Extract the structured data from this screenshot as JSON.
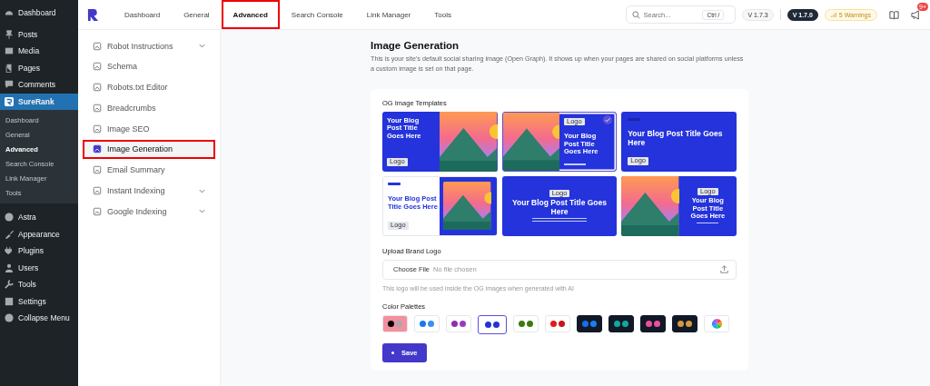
{
  "wp_menu": [
    {
      "label": "Dashboard",
      "current": false
    },
    {
      "label": "Posts",
      "current": false
    },
    {
      "label": "Media",
      "current": false
    },
    {
      "label": "Pages",
      "current": false
    },
    {
      "label": "Comments",
      "current": false
    },
    {
      "label": "SureRank",
      "current": true,
      "submenu": [
        {
          "label": "Dashboard",
          "selected": false
        },
        {
          "label": "General",
          "selected": false
        },
        {
          "label": "Advanced",
          "selected": true
        },
        {
          "label": "Search Console",
          "selected": false
        },
        {
          "label": "Link Manager",
          "selected": false
        },
        {
          "label": "Tools",
          "selected": false
        }
      ]
    },
    {
      "label": "Astra",
      "current": false
    },
    {
      "label": "Appearance",
      "current": false
    },
    {
      "label": "Plugins",
      "current": false
    },
    {
      "label": "Users",
      "current": false
    },
    {
      "label": "Tools",
      "current": false
    },
    {
      "label": "Settings",
      "current": false
    },
    {
      "label": "Collapse Menu",
      "current": false
    }
  ],
  "top_tabs": [
    {
      "label": "Dashboard",
      "selected": false,
      "highlighted": false
    },
    {
      "label": "General",
      "selected": false,
      "highlighted": false
    },
    {
      "label": "Advanced",
      "selected": true,
      "highlighted": true
    },
    {
      "label": "Search Console",
      "selected": false,
      "highlighted": false
    },
    {
      "label": "Link Manager",
      "selected": false,
      "highlighted": false
    },
    {
      "label": "Tools",
      "selected": false,
      "highlighted": false
    }
  ],
  "search": {
    "placeholder": "Search...",
    "shortcut": "Ctrl /"
  },
  "versions": [
    {
      "label": "V 1.7.3",
      "kind": "light"
    },
    {
      "label": "V 1.7.0",
      "kind": "dark"
    }
  ],
  "warnings": "5 Warnings",
  "notification_count": "9+",
  "side_nav": [
    {
      "label": "Robot Instructions",
      "expandable": true,
      "selected": false,
      "highlighted": false
    },
    {
      "label": "Schema",
      "expandable": false,
      "selected": false,
      "highlighted": false
    },
    {
      "label": "Robots.txt Editor",
      "expandable": false,
      "selected": false,
      "highlighted": false
    },
    {
      "label": "Breadcrumbs",
      "expandable": false,
      "selected": false,
      "highlighted": false
    },
    {
      "label": "Image SEO",
      "expandable": false,
      "selected": false,
      "highlighted": false
    },
    {
      "label": "Image Generation",
      "expandable": false,
      "selected": true,
      "highlighted": true
    },
    {
      "label": "Email Summary",
      "expandable": false,
      "selected": false,
      "highlighted": false
    },
    {
      "label": "Instant Indexing",
      "expandable": true,
      "selected": false,
      "highlighted": false
    },
    {
      "label": "Google Indexing",
      "expandable": true,
      "selected": false,
      "highlighted": false
    }
  ],
  "page": {
    "title": "Image Generation",
    "description": "This is your site's default social sharing image (Open Graph). It shows up when your pages are shared on social platforms unless a custom image is set on that page."
  },
  "templates_label": "OG Image Templates",
  "templates": [
    {
      "kind": "text-left",
      "title": "Your Blog Post Title Goes Here",
      "logo": "Logo",
      "selected": false
    },
    {
      "kind": "image-left",
      "title": "Your Blog Post Title Goes Here",
      "logo": "Logo",
      "selected": true
    },
    {
      "kind": "text-only",
      "title": "Your Blog Post Title Goes Here",
      "logo": "Logo",
      "selected": false
    },
    {
      "kind": "white-left",
      "title": "Your Blog Post Title Goes Here",
      "logo": "Logo",
      "selected": false
    },
    {
      "kind": "centered",
      "title": "Your Blog Post Title Goes Here",
      "logo": "Logo",
      "selected": false
    },
    {
      "kind": "image-left-centered",
      "title": "Your Blog Post Title Goes Here",
      "logo": "Logo",
      "selected": false
    }
  ],
  "upload": {
    "label": "Upload Brand Logo",
    "button": "Choose File",
    "value": "No file chosen",
    "help": "This logo will be used inside the OG images when generated with AI"
  },
  "palettes_label": "Color Palettes",
  "palettes": [
    {
      "kind": "light",
      "color": "#f48fa0",
      "dots": [
        {
          "color": "#000000"
        },
        {
          "color": "#a8a8b0"
        }
      ],
      "selected": false
    },
    {
      "kind": "light",
      "color": "#ffffff",
      "dots": [
        {
          "color": "#1877f2"
        },
        {
          "color": "#3b8ef5"
        }
      ],
      "selected": false
    },
    {
      "kind": "light",
      "color": "#ffffff",
      "dots": [
        {
          "color": "#8e2fb0"
        },
        {
          "color": "#9b38c0"
        }
      ],
      "selected": false
    },
    {
      "kind": "light",
      "color": "#ffffff",
      "dots": [
        {
          "color": "#2233d8"
        },
        {
          "color": "#2233d8"
        }
      ],
      "selected": true
    },
    {
      "kind": "light",
      "color": "#ffffff",
      "dots": [
        {
          "color": "#3a7a10"
        },
        {
          "color": "#3a7a10"
        }
      ],
      "selected": false
    },
    {
      "kind": "light",
      "color": "#ffffff",
      "dots": [
        {
          "color": "#e01b1b"
        },
        {
          "color": "#c8141e"
        }
      ],
      "selected": false
    },
    {
      "kind": "dark",
      "color": "#111827",
      "dots": [
        {
          "color": "#1a6ee8"
        },
        {
          "color": "#1a7ff0"
        }
      ],
      "selected": false
    },
    {
      "kind": "dark",
      "color": "#111827",
      "dots": [
        {
          "color": "#12a89a"
        },
        {
          "color": "#12a89a"
        }
      ],
      "selected": false
    },
    {
      "kind": "dark",
      "color": "#111827",
      "dots": [
        {
          "color": "#ec4f9c"
        },
        {
          "color": "#ec4f9c"
        }
      ],
      "selected": false
    },
    {
      "kind": "dark",
      "color": "#111827",
      "dots": [
        {
          "color": "#d49a3c"
        },
        {
          "color": "#d49a3c"
        }
      ],
      "selected": false
    },
    {
      "kind": "wheel",
      "color": "#ffffff",
      "selected": false
    }
  ],
  "save_button": "Save"
}
